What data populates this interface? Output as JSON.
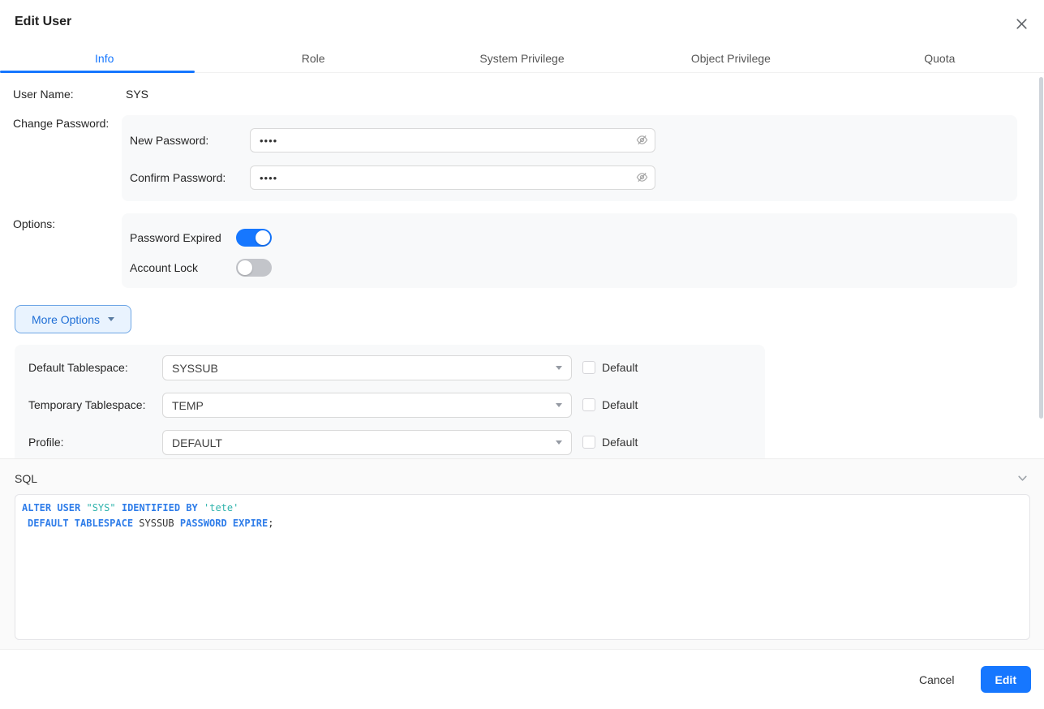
{
  "dialog": {
    "title": "Edit User"
  },
  "icons": {
    "close": "✕"
  },
  "tabs": {
    "active": "Info",
    "items": [
      {
        "label": "Info"
      },
      {
        "label": "Role"
      },
      {
        "label": "System Privilege"
      },
      {
        "label": "Object Privilege"
      },
      {
        "label": "Quota"
      }
    ]
  },
  "info_tab": {
    "user_name": {
      "label": "User Name:",
      "value": "SYS"
    },
    "change_password": {
      "label": "Change Password:",
      "new_password": {
        "label": "New Password:",
        "value": "••••"
      },
      "confirm_password": {
        "label": "Confirm Password:",
        "value": "••••"
      }
    },
    "options": {
      "label": "Options:",
      "password_expired": {
        "label": "Password Expired",
        "checked": true
      },
      "account_lock": {
        "label": "Account Lock",
        "checked": false
      }
    },
    "more_options": {
      "label": "More Options"
    },
    "more_section": {
      "rows": [
        {
          "label": "Default Tablespace:",
          "value": "SYSSUB",
          "checkbox_label": "Default",
          "checked": false
        },
        {
          "label": "Temporary Tablespace:",
          "value": "TEMP",
          "checkbox_label": "Default",
          "checked": false
        },
        {
          "label": "Profile:",
          "value": "DEFAULT",
          "checkbox_label": "Default",
          "checked": false
        }
      ]
    }
  },
  "sql": {
    "header": "SQL",
    "line1": {
      "kw1": "ALTER USER",
      "str1": "\"SYS\"",
      "kw2": "IDENTIFIED BY",
      "str2": "'tete'"
    },
    "line2": {
      "kw1": "DEFAULT TABLESPACE",
      "ident": "SYSSUB",
      "kw2": "PASSWORD EXPIRE",
      "punct": ";"
    }
  },
  "footer": {
    "cancel_label": "Cancel",
    "edit_label": "Edit"
  },
  "colors": {
    "primary": "#1677ff",
    "sql_keyword": "#2f7de9",
    "sql_string": "#2fb3ac"
  }
}
